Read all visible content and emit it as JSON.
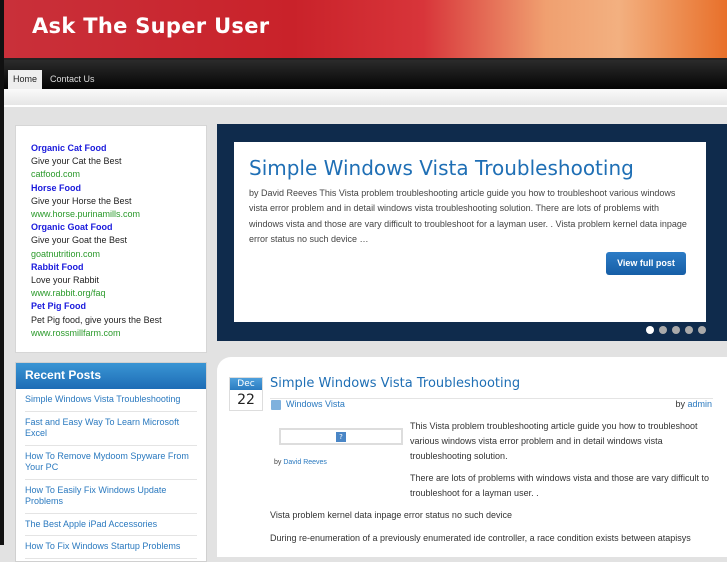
{
  "site": {
    "title": "Ask The Super User"
  },
  "nav": [
    {
      "label": "Home"
    },
    {
      "label": "Contact Us"
    }
  ],
  "ads": [
    {
      "title": "Organic Cat Food",
      "desc": "Give your Cat the Best",
      "url": "catfood.com"
    },
    {
      "title": "Horse Food",
      "desc": "Give your Horse the Best",
      "url": "www.horse.purinamills.com"
    },
    {
      "title": "Organic Goat Food",
      "desc": "Give your Goat the Best",
      "url": "goatnutrition.com"
    },
    {
      "title": "Rabbit Food",
      "desc": "Love your Rabbit",
      "url": "www.rabbit.org/faq"
    },
    {
      "title": "Pet Pig Food",
      "desc": "Pet Pig food, give yours the Best",
      "url": "www.rossmillfarm.com"
    }
  ],
  "slider": {
    "title": "Simple Windows Vista Troubleshooting",
    "excerpt": "by David Reeves This Vista problem troubleshooting article guide you how to troubleshoot various windows vista error problem and in detail windows vista troubleshooting solution. There are lots of problems with windows vista and those are vary difficult to troubleshoot for a layman user. . Vista problem kernel data inpage error status no such device …",
    "button": "View full post",
    "slide_count": 5,
    "active_slide": 1
  },
  "recent": {
    "heading": "Recent Posts",
    "items": [
      "Simple Windows Vista Troubleshooting",
      "Fast and Easy Way To Learn Microsoft Excel",
      "How To Remove Mydoom Spyware From Your PC",
      "How To Easily Fix Windows Update Problems",
      "The Best Apple iPad Accessories",
      "How To Fix Windows Startup Problems"
    ]
  },
  "post": {
    "month": "Dec",
    "day": "22",
    "title": "Simple Windows Vista Troubleshooting",
    "category": "Windows Vista",
    "by": "by",
    "author": "admin",
    "image_placeholder": "?",
    "image_by": "by",
    "image_author": "David Reeves",
    "p1": "This Vista problem troubleshooting article guide you how to troubleshoot various windows vista error problem and in detail windows vista troubleshooting solution.",
    "p2": "There are lots of problems with windows vista and those are vary difficult to troubleshoot for a layman user. .",
    "p3": "Vista problem kernel data inpage error status no such device",
    "p4": "During re-enumeration of a previously enumerated ide controller, a race condition exists between atapisys"
  }
}
